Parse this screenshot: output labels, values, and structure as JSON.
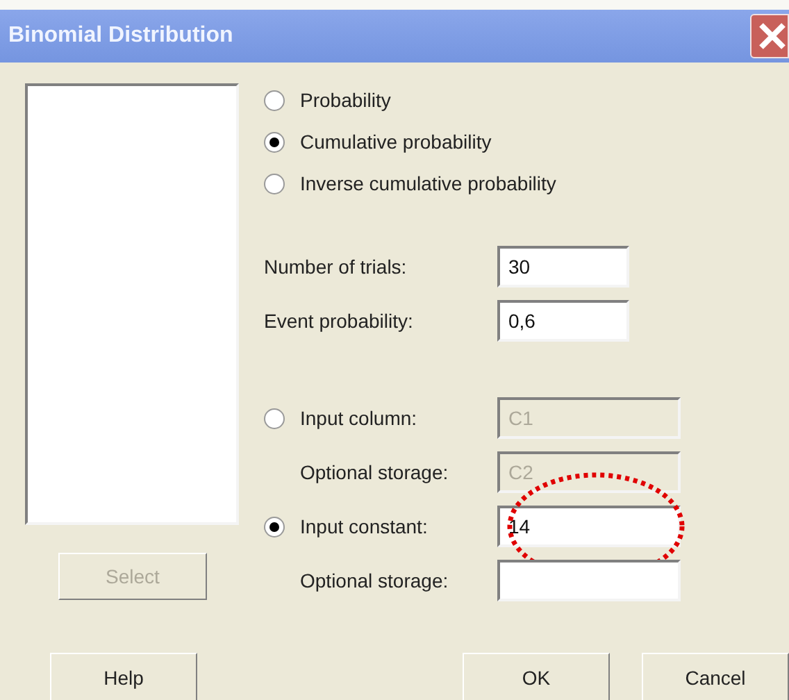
{
  "window": {
    "title": "Binomial Distribution"
  },
  "modes": [
    {
      "label": "Probability",
      "selected": false
    },
    {
      "label": "Cumulative probability",
      "selected": true
    },
    {
      "label": "Inverse cumulative probability",
      "selected": false
    }
  ],
  "parameters": [
    {
      "label": "Number of trials:",
      "value": "30"
    },
    {
      "label": "Event probability:",
      "value": "0,6"
    }
  ],
  "inputs": [
    {
      "kind": "radio",
      "label": "Input column:",
      "selected": false,
      "value": "C1",
      "disabled": true
    },
    {
      "kind": "storage",
      "label": "Optional storage:",
      "value": "C2",
      "disabled": true
    },
    {
      "kind": "radio",
      "label": "Input constant:",
      "selected": true,
      "value": "14",
      "disabled": false,
      "highlighted": true
    },
    {
      "kind": "storage",
      "label": "Optional storage:",
      "disabled": false
    }
  ],
  "select_button": {
    "label": "Select",
    "disabled": true
  },
  "buttons": [
    {
      "label": "Help"
    },
    {
      "label": "OK"
    },
    {
      "label": "Cancel"
    }
  ]
}
